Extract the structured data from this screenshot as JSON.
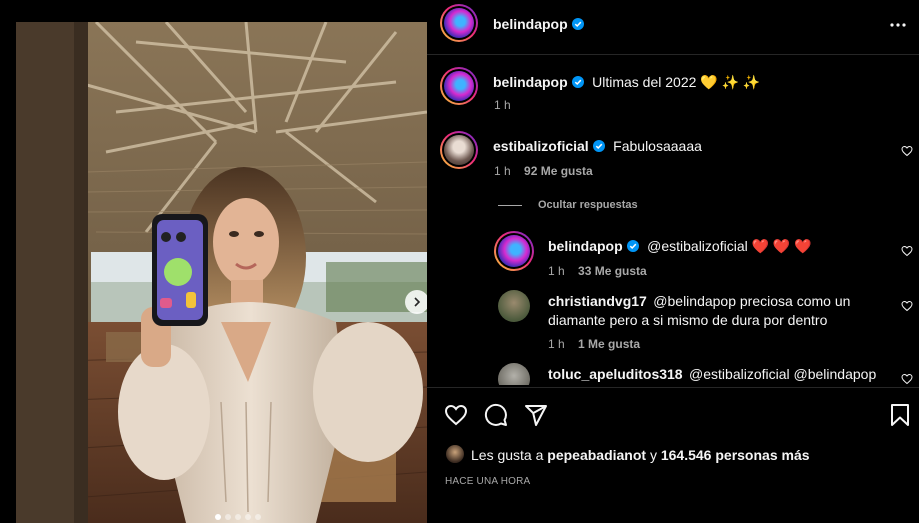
{
  "post": {
    "author": "belindapop",
    "more_icon": "more-horizontal-icon",
    "accent_color": "#0095f6"
  },
  "caption": {
    "author": "belindapop",
    "text": "Ultimas del 2022 💛 ✨ ✨",
    "time": "1 h"
  },
  "comments": [
    {
      "author": "estibalizoficial",
      "text": "Fabulosaaaaa",
      "time": "1 h",
      "likes": "92 Me gusta",
      "hide_replies": "Ocultar respuestas",
      "replies": [
        {
          "author": "belindapop",
          "text": "@estibalizoficial ❤️ ❤️ ❤️",
          "time": "1 h",
          "likes": "33 Me gusta"
        },
        {
          "author": "christiandvg17",
          "text": "@belindapop preciosa como un diamante pero a si mismo de dura por dentro",
          "time": "1 h",
          "likes": "1 Me gusta"
        },
        {
          "author": "toluc_apeluditos318",
          "text": "@estibalizoficial @belindapop"
        }
      ]
    }
  ],
  "likes_line": {
    "prefix": "Les gusta a",
    "user": "pepeabadianot",
    "joiner": "y",
    "count": "164.546 personas más"
  },
  "timestamp": "HACE UNA HORA",
  "carousel": {
    "total": 5,
    "active": 0
  }
}
